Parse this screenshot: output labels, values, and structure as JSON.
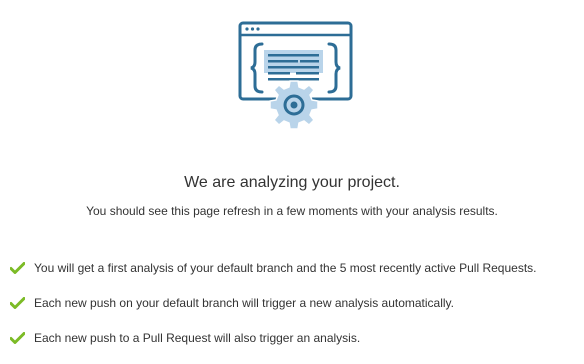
{
  "colors": {
    "icon_dark_blue": "#2d6d96",
    "icon_light_blue": "#b9d4ea",
    "check_green": "#7cbb26",
    "text": "#333333"
  },
  "illustration": {
    "icon": "code-window-with-gear-icon"
  },
  "status": {
    "headline": "We are analyzing your project.",
    "subline": "You should see this page refresh in a few moments with your analysis results."
  },
  "checklist": {
    "icon": "checkmark-icon",
    "items": [
      {
        "text": "You will get a first analysis of your default branch and the 5 most recently active Pull Requests."
      },
      {
        "text": "Each new push on your default branch will trigger a new analysis automatically."
      },
      {
        "text": "Each new push to a Pull Request will also trigger an analysis."
      }
    ]
  }
}
